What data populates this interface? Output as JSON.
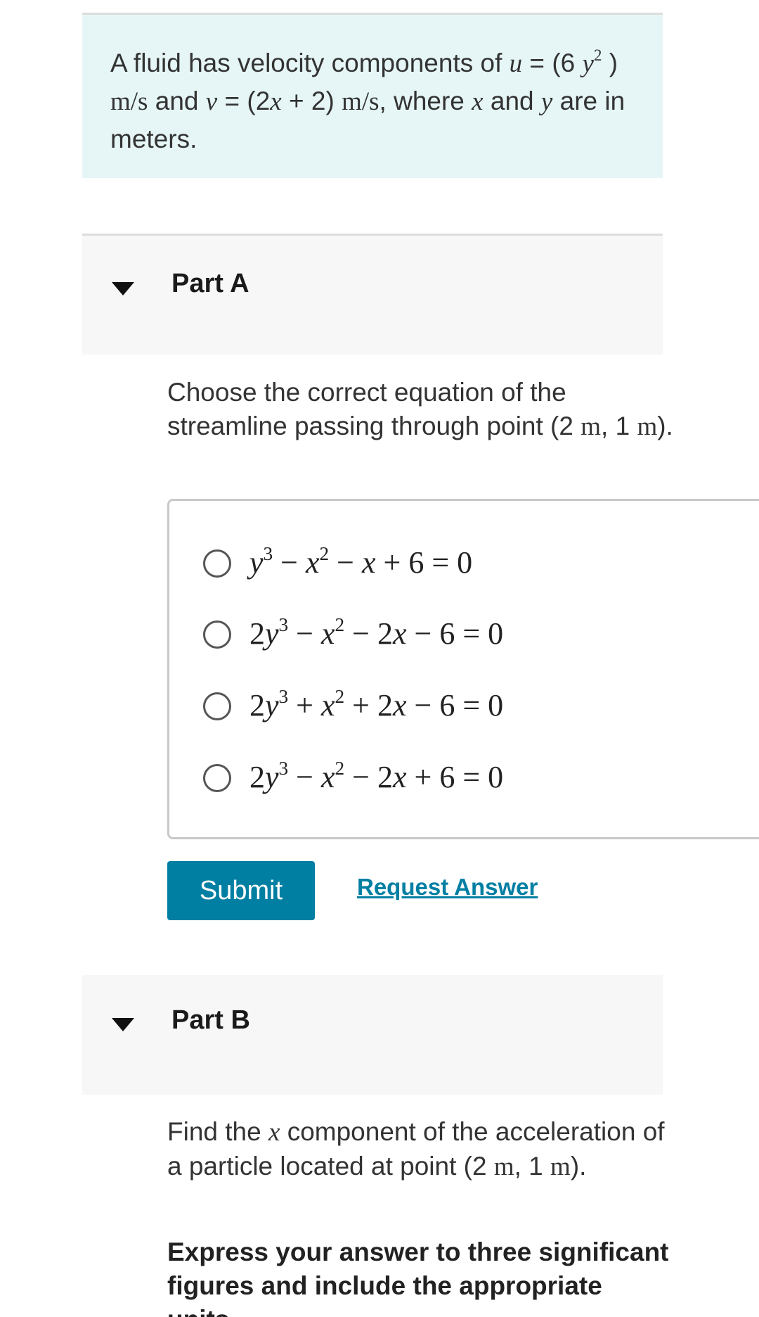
{
  "intro": {
    "p1": "A fluid has velocity components of ",
    "u_var": "u",
    "p2": " = (6 ",
    "y_var": "y",
    "exp_2": "2",
    "p3": " ) ",
    "unit_ms": "m/s",
    "p4": " and ",
    "v_var": "v",
    "p5": " = (2",
    "x_var": "x",
    "p6": " + 2) ",
    "unit_ms2": "m/s",
    "p7": ", where ",
    "x_var2": "x",
    "p8": " and ",
    "y_var2": "y",
    "p9": " are in meters."
  },
  "part_a": {
    "title": "Part A",
    "question_p1": "Choose the correct equation of the streamline passing through point (2 ",
    "unit_m1": "m",
    "question_p2": ", 1 ",
    "unit_m2": "m",
    "question_p3": ").",
    "choices": [
      {
        "c": "",
        "y": "y",
        "e3": "3",
        "op1": " − ",
        "x": "x",
        "e2": "2",
        "op2": " − ",
        "k": "",
        "x2": "x",
        "tail": " + 6 = 0"
      },
      {
        "c": "2",
        "y": "y",
        "e3": "3",
        "op1": " − ",
        "x": "x",
        "e2": "2",
        "op2": " − ",
        "k": "2",
        "x2": "x",
        "tail": " − 6 = 0"
      },
      {
        "c": "2",
        "y": "y",
        "e3": "3",
        "op1": " + ",
        "x": "x",
        "e2": "2",
        "op2": " + ",
        "k": "2",
        "x2": "x",
        "tail": " − 6 = 0"
      },
      {
        "c": "2",
        "y": "y",
        "e3": "3",
        "op1": " − ",
        "x": "x",
        "e2": "2",
        "op2": " − ",
        "k": "2",
        "x2": "x",
        "tail": " + 6 = 0"
      }
    ],
    "submit_label": "Submit",
    "request_label": "Request Answer"
  },
  "part_b": {
    "title": "Part B",
    "question_p1": "Find the ",
    "x_var": "x",
    "question_p2": " component of the acceleration of a particle located at point (2 ",
    "unit_m1": "m",
    "question_p3": ", 1 ",
    "unit_m2": "m",
    "question_p4": ").",
    "instruction": "Express your answer to three significant figures and include the appropriate units."
  }
}
